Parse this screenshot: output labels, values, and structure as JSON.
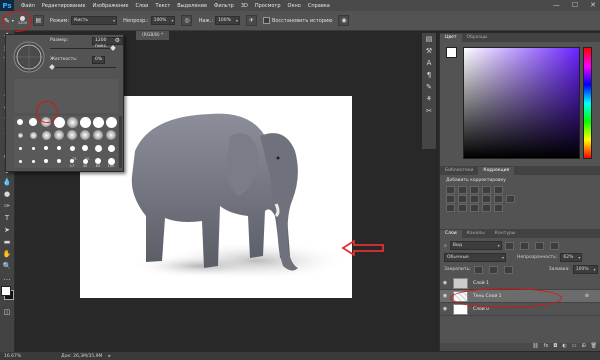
{
  "app": {
    "logo": "Ps"
  },
  "menu": [
    "Файл",
    "Редактирование",
    "Изображение",
    "Слои",
    "Текст",
    "Выделение",
    "Фильтр",
    "3D",
    "Просмотр",
    "Окно",
    "Справка"
  ],
  "window_controls": [
    "—",
    "☐",
    "✕"
  ],
  "options_bar": {
    "brush_size": "1200",
    "mode_label": "Режим:",
    "mode_value": "Кисть",
    "opacity_label": "Непрозр.:",
    "opacity_value": "100%",
    "flow_label": "Наж.:",
    "flow_value": "100%",
    "history_label": "Восстановить историю"
  },
  "brush_picker": {
    "size_label": "Размер:",
    "size_value": "1200 пикс.",
    "hardness_label": "Жесткость:",
    "hardness_value": "0%",
    "hardness_percent": 0,
    "tip_labels": [
      "17",
      "45",
      "65",
      "100",
      "25",
      "50"
    ]
  },
  "document": {
    "tab_title": "(RGB/8) *"
  },
  "status": {
    "zoom": "16.67%",
    "doc_info": "Док: 26,3M/35,9M"
  },
  "color_panel": {
    "tabs": [
      "Цвет",
      "Образцы"
    ]
  },
  "adjustments_panel": {
    "tabs": [
      "Библиотеки",
      "Коррекция"
    ],
    "title": "Добавить корректировку"
  },
  "layers_panel": {
    "tabs": [
      "Слои",
      "Каналы",
      "Контуры"
    ],
    "kind_filter": "Вид",
    "blend_mode": "Обычные",
    "opacity_label": "Непрозрачность:",
    "opacity_value": "62%",
    "lock_label": "Закрепить:",
    "fill_label": "Заливка:",
    "fill_value": "100%",
    "layers": [
      {
        "name": "Слой 1",
        "visible": true,
        "selected": false
      },
      {
        "name": "Тень Слой 1",
        "visible": true,
        "selected": true
      },
      {
        "name": "Слой 0",
        "visible": true,
        "selected": false
      }
    ]
  },
  "colors": {
    "ui_dark": "#282828",
    "panel": "#535353",
    "highlight_ring": "#dd1111",
    "arrow": "#e03030"
  }
}
